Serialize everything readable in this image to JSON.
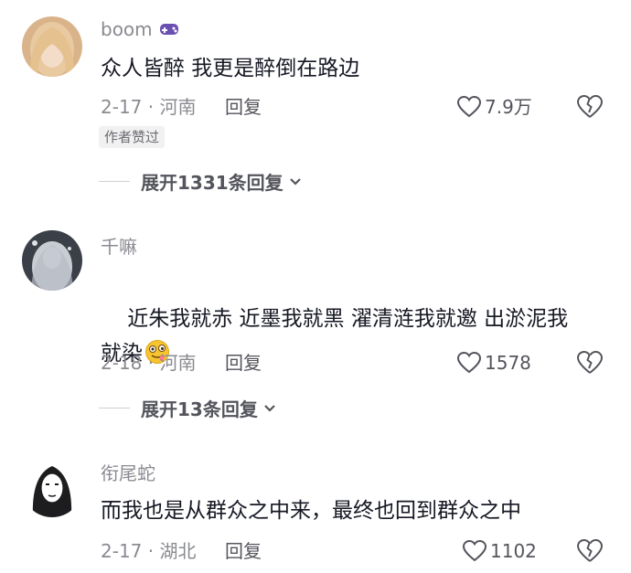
{
  "comments": [
    {
      "username": "boom",
      "username_icon": "game-controller-icon",
      "text": "众人皆醉 我更是醉倒在路边",
      "date_location": "2-17 · 河南",
      "reply_label": "回复",
      "likes": "7.9万",
      "author_badge": "作者赞过",
      "expand_label": "展开1331条回复"
    },
    {
      "username": "千嘛",
      "text": "近朱我就赤 近墨我就黑 濯清涟我就邀 出淤泥我\n就染",
      "emoji": "drooling-face-icon",
      "date_location": "2-18 · 河南",
      "reply_label": "回复",
      "likes": "1578",
      "expand_label": "展开13条回复"
    },
    {
      "username": "衔尾蛇",
      "text": "而我也是从群众之中来，最终也回到群众之中",
      "date_location": "2-17 · 湖北",
      "reply_label": "回复",
      "likes": "1102"
    }
  ],
  "colors": {
    "text": "#161823",
    "secondary": "#8a8b91",
    "icon": "#54555c",
    "emoji": "#f7c431"
  }
}
